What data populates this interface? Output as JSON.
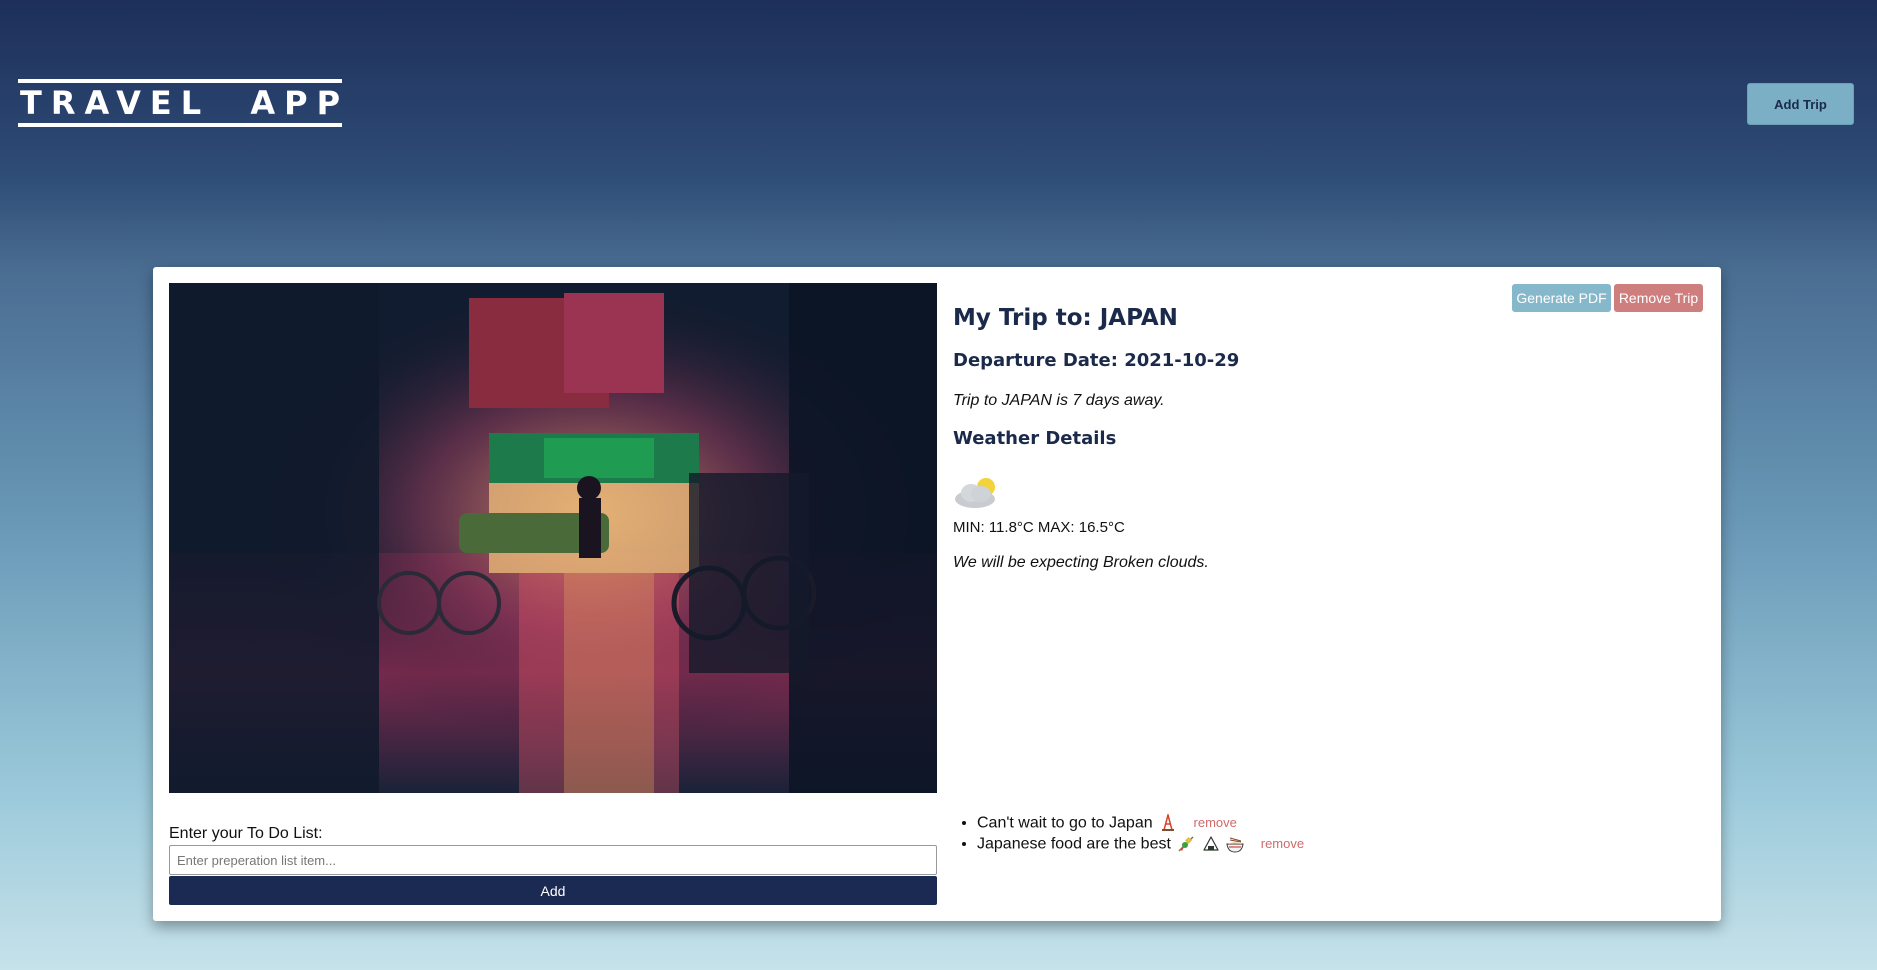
{
  "header": {
    "logo": "TRAVEL  APP",
    "add_trip": "Add Trip"
  },
  "trip": {
    "title": "My Trip to: JAPAN",
    "departure": "Departure Date: 2021-10-29",
    "countdown": "Trip to JAPAN is 7 days away.",
    "generate_pdf": "Generate PDF",
    "remove_trip": "Remove Trip"
  },
  "weather": {
    "heading": "Weather Details",
    "icon": "broken-clouds-icon",
    "temps": "MIN: 11.8°C MAX: 16.5°C",
    "forecast": "We will be expecting Broken clouds."
  },
  "todo": {
    "label": "Enter your To Do List:",
    "placeholder": "Enter preperation list item...",
    "value": "",
    "add": "Add",
    "items": [
      {
        "text": "Can't wait to go to Japan",
        "emoji": [
          "tokyo-tower-icon"
        ],
        "remove": "remove"
      },
      {
        "text": "Japanese food are the best",
        "emoji": [
          "oden-icon",
          "rice-ball-icon",
          "ramen-icon"
        ],
        "remove": "remove"
      }
    ]
  },
  "colors": {
    "navy": "#1b2a52",
    "pdf_button": "#86b8cc",
    "remove_button": "#cf7e7e",
    "remove_link": "#cf6b6b",
    "add_trip_button": "#7aafc6"
  }
}
